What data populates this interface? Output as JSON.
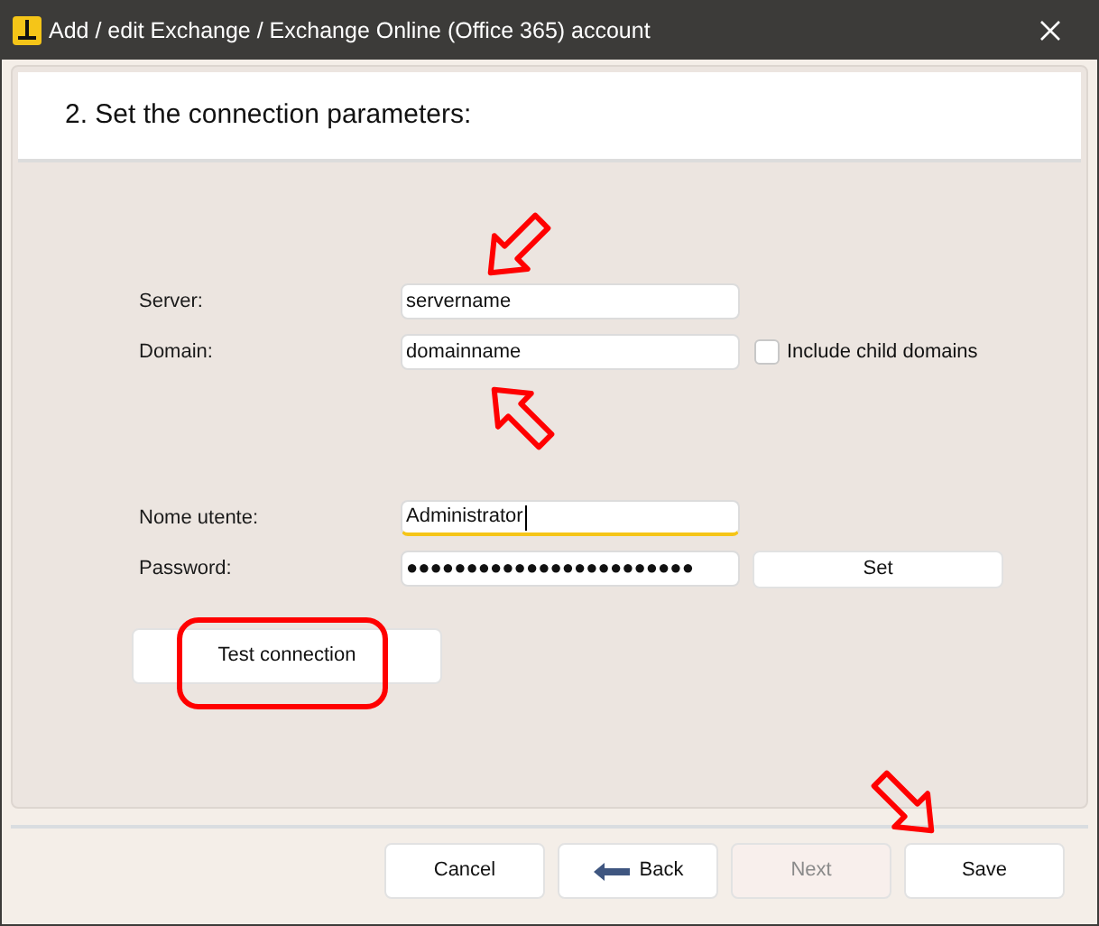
{
  "window": {
    "title": "Add / edit Exchange / Exchange Online (Office 365) account"
  },
  "step": {
    "heading": "2. Set the connection parameters:"
  },
  "server_fields": [
    {
      "label": "Server:",
      "value": "servername",
      "focused": false
    },
    {
      "label": "Domain:",
      "value": "domainname",
      "focused": false
    }
  ],
  "include_child_domains": {
    "label": "Include child domains",
    "checked": false
  },
  "credential_fields": [
    {
      "label": "Nome utente:",
      "value": "Administrator",
      "focused": true
    },
    {
      "label": "Password:",
      "value": "●●●●●●●●●●●●●●●●●●●●●●●●",
      "focused": false
    }
  ],
  "set_button": {
    "label": "Set"
  },
  "test_button": {
    "label": "Test connection"
  },
  "footer_buttons": [
    {
      "kind": "plain",
      "label": "Cancel",
      "disabled": false
    },
    {
      "kind": "back",
      "label": "Back",
      "disabled": false
    },
    {
      "kind": "plain",
      "label": "Next",
      "disabled": true
    },
    {
      "kind": "plain",
      "label": "Save",
      "disabled": false
    }
  ]
}
